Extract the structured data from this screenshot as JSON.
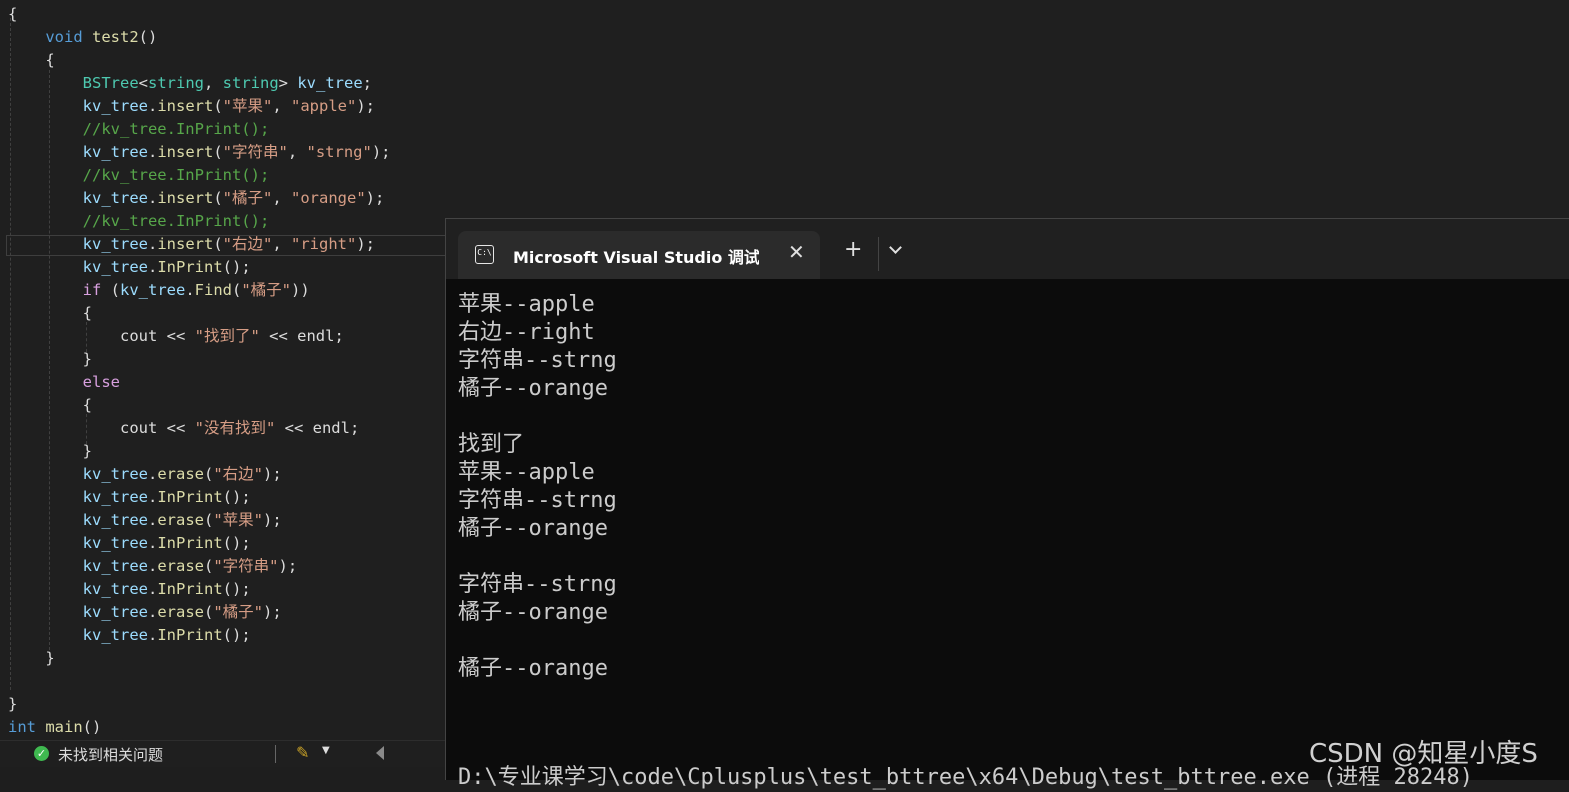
{
  "editor": {
    "lines": [
      {
        "parts": [
          {
            "c": "pl",
            "t": "{"
          }
        ]
      },
      {
        "parts": [
          {
            "c": "pl",
            "t": "    "
          },
          {
            "c": "kw",
            "t": "void"
          },
          {
            "c": "pl",
            "t": " "
          },
          {
            "c": "fn",
            "t": "test2"
          },
          {
            "c": "pl",
            "t": "()"
          }
        ]
      },
      {
        "parts": [
          {
            "c": "pl",
            "t": "    {"
          }
        ]
      },
      {
        "parts": [
          {
            "c": "pl",
            "t": "        "
          },
          {
            "c": "ty",
            "t": "BSTree"
          },
          {
            "c": "pl",
            "t": "<"
          },
          {
            "c": "ty",
            "t": "string"
          },
          {
            "c": "pl",
            "t": ", "
          },
          {
            "c": "ty",
            "t": "string"
          },
          {
            "c": "pl",
            "t": "> "
          },
          {
            "c": "id",
            "t": "kv_tree"
          },
          {
            "c": "pl",
            "t": ";"
          }
        ]
      },
      {
        "parts": [
          {
            "c": "pl",
            "t": "        "
          },
          {
            "c": "id",
            "t": "kv_tree"
          },
          {
            "c": "pl",
            "t": "."
          },
          {
            "c": "fn",
            "t": "insert"
          },
          {
            "c": "pl",
            "t": "("
          },
          {
            "c": "st",
            "t": "\"苹果\""
          },
          {
            "c": "pl",
            "t": ", "
          },
          {
            "c": "st",
            "t": "\"apple\""
          },
          {
            "c": "pl",
            "t": ");"
          }
        ]
      },
      {
        "parts": [
          {
            "c": "pl",
            "t": "        "
          },
          {
            "c": "cm",
            "t": "//kv_tree.InPrint();"
          }
        ]
      },
      {
        "parts": [
          {
            "c": "pl",
            "t": "        "
          },
          {
            "c": "id",
            "t": "kv_tree"
          },
          {
            "c": "pl",
            "t": "."
          },
          {
            "c": "fn",
            "t": "insert"
          },
          {
            "c": "pl",
            "t": "("
          },
          {
            "c": "st",
            "t": "\"字符串\""
          },
          {
            "c": "pl",
            "t": ", "
          },
          {
            "c": "st",
            "t": "\"strng\""
          },
          {
            "c": "pl",
            "t": ");"
          }
        ]
      },
      {
        "parts": [
          {
            "c": "pl",
            "t": "        "
          },
          {
            "c": "cm",
            "t": "//kv_tree.InPrint();"
          }
        ]
      },
      {
        "parts": [
          {
            "c": "pl",
            "t": "        "
          },
          {
            "c": "id",
            "t": "kv_tree"
          },
          {
            "c": "pl",
            "t": "."
          },
          {
            "c": "fn",
            "t": "insert"
          },
          {
            "c": "pl",
            "t": "("
          },
          {
            "c": "st",
            "t": "\"橘子\""
          },
          {
            "c": "pl",
            "t": ", "
          },
          {
            "c": "st",
            "t": "\"orange\""
          },
          {
            "c": "pl",
            "t": ");"
          }
        ]
      },
      {
        "parts": [
          {
            "c": "pl",
            "t": "        "
          },
          {
            "c": "cm",
            "t": "//kv_tree.InPrint();"
          }
        ]
      },
      {
        "parts": [
          {
            "c": "pl",
            "t": "        "
          },
          {
            "c": "id",
            "t": "kv_tree"
          },
          {
            "c": "pl",
            "t": "."
          },
          {
            "c": "fn",
            "t": "insert"
          },
          {
            "c": "pl",
            "t": "("
          },
          {
            "c": "st",
            "t": "\"右边\""
          },
          {
            "c": "pl",
            "t": ", "
          },
          {
            "c": "st",
            "t": "\"right\""
          },
          {
            "c": "pl",
            "t": ");"
          }
        ]
      },
      {
        "parts": [
          {
            "c": "pl",
            "t": "        "
          },
          {
            "c": "id",
            "t": "kv_tree"
          },
          {
            "c": "pl",
            "t": "."
          },
          {
            "c": "fn",
            "t": "InPrint"
          },
          {
            "c": "pl",
            "t": "();"
          }
        ]
      },
      {
        "parts": [
          {
            "c": "pl",
            "t": "        "
          },
          {
            "c": "kw2",
            "t": "if"
          },
          {
            "c": "pl",
            "t": " ("
          },
          {
            "c": "id",
            "t": "kv_tree"
          },
          {
            "c": "pl",
            "t": "."
          },
          {
            "c": "fn",
            "t": "Find"
          },
          {
            "c": "pl",
            "t": "("
          },
          {
            "c": "st",
            "t": "\"橘子\""
          },
          {
            "c": "pl",
            "t": "))"
          }
        ]
      },
      {
        "parts": [
          {
            "c": "pl",
            "t": "        {"
          }
        ]
      },
      {
        "parts": [
          {
            "c": "pl",
            "t": "            cout << "
          },
          {
            "c": "st",
            "t": "\"找到了\""
          },
          {
            "c": "pl",
            "t": " << endl;"
          }
        ]
      },
      {
        "parts": [
          {
            "c": "pl",
            "t": "        }"
          }
        ]
      },
      {
        "parts": [
          {
            "c": "pl",
            "t": "        "
          },
          {
            "c": "kw2",
            "t": "else"
          }
        ]
      },
      {
        "parts": [
          {
            "c": "pl",
            "t": "        {"
          }
        ]
      },
      {
        "parts": [
          {
            "c": "pl",
            "t": "            cout << "
          },
          {
            "c": "st",
            "t": "\"没有找到\""
          },
          {
            "c": "pl",
            "t": " << endl;"
          }
        ]
      },
      {
        "parts": [
          {
            "c": "pl",
            "t": "        }"
          }
        ]
      },
      {
        "parts": [
          {
            "c": "pl",
            "t": "        "
          },
          {
            "c": "id",
            "t": "kv_tree"
          },
          {
            "c": "pl",
            "t": "."
          },
          {
            "c": "fn",
            "t": "erase"
          },
          {
            "c": "pl",
            "t": "("
          },
          {
            "c": "st",
            "t": "\"右边\""
          },
          {
            "c": "pl",
            "t": ");"
          }
        ]
      },
      {
        "parts": [
          {
            "c": "pl",
            "t": "        "
          },
          {
            "c": "id",
            "t": "kv_tree"
          },
          {
            "c": "pl",
            "t": "."
          },
          {
            "c": "fn",
            "t": "InPrint"
          },
          {
            "c": "pl",
            "t": "();"
          }
        ]
      },
      {
        "parts": [
          {
            "c": "pl",
            "t": "        "
          },
          {
            "c": "id",
            "t": "kv_tree"
          },
          {
            "c": "pl",
            "t": "."
          },
          {
            "c": "fn",
            "t": "erase"
          },
          {
            "c": "pl",
            "t": "("
          },
          {
            "c": "st",
            "t": "\"苹果\""
          },
          {
            "c": "pl",
            "t": ");"
          }
        ]
      },
      {
        "parts": [
          {
            "c": "pl",
            "t": "        "
          },
          {
            "c": "id",
            "t": "kv_tree"
          },
          {
            "c": "pl",
            "t": "."
          },
          {
            "c": "fn",
            "t": "InPrint"
          },
          {
            "c": "pl",
            "t": "();"
          }
        ]
      },
      {
        "parts": [
          {
            "c": "pl",
            "t": "        "
          },
          {
            "c": "id",
            "t": "kv_tree"
          },
          {
            "c": "pl",
            "t": "."
          },
          {
            "c": "fn",
            "t": "erase"
          },
          {
            "c": "pl",
            "t": "("
          },
          {
            "c": "st",
            "t": "\"字符串\""
          },
          {
            "c": "pl",
            "t": ");"
          }
        ]
      },
      {
        "parts": [
          {
            "c": "pl",
            "t": "        "
          },
          {
            "c": "id",
            "t": "kv_tree"
          },
          {
            "c": "pl",
            "t": "."
          },
          {
            "c": "fn",
            "t": "InPrint"
          },
          {
            "c": "pl",
            "t": "();"
          }
        ]
      },
      {
        "parts": [
          {
            "c": "pl",
            "t": "        "
          },
          {
            "c": "id",
            "t": "kv_tree"
          },
          {
            "c": "pl",
            "t": "."
          },
          {
            "c": "fn",
            "t": "erase"
          },
          {
            "c": "pl",
            "t": "("
          },
          {
            "c": "st",
            "t": "\"橘子\""
          },
          {
            "c": "pl",
            "t": ");"
          }
        ]
      },
      {
        "parts": [
          {
            "c": "pl",
            "t": "        "
          },
          {
            "c": "id",
            "t": "kv_tree"
          },
          {
            "c": "pl",
            "t": "."
          },
          {
            "c": "fn",
            "t": "InPrint"
          },
          {
            "c": "pl",
            "t": "();"
          }
        ]
      },
      {
        "parts": [
          {
            "c": "pl",
            "t": "    }"
          }
        ]
      },
      {
        "parts": [
          {
            "c": "pl",
            "t": ""
          }
        ]
      },
      {
        "parts": [
          {
            "c": "pl",
            "t": "}"
          }
        ]
      },
      {
        "parts": [
          {
            "c": "kw",
            "t": "int"
          },
          {
            "c": "pl",
            "t": " "
          },
          {
            "c": "fn",
            "t": "main"
          },
          {
            "c": "pl",
            "t": "()"
          }
        ]
      }
    ]
  },
  "status_bar": {
    "issues_text": "未找到相关问题",
    "check_icon": "check-circle-icon",
    "brush_icon": "cleanup-brush-icon"
  },
  "terminal": {
    "tab_title": "Microsoft Visual Studio 调试控",
    "tab_icon": "console-icon",
    "tab_icon_text": "C:\\",
    "close_glyph": "✕",
    "new_tab_glyph": "+",
    "output": [
      "苹果--apple",
      "右边--right",
      "字符串--strng",
      "橘子--orange",
      "",
      "找到了",
      "苹果--apple",
      "字符串--strng",
      "橘子--orange",
      "",
      "字符串--strng",
      "橘子--orange",
      "",
      "橘子--orange"
    ],
    "exit_path": "D:\\专业课学习\\code\\Cplusplus\\test_bttree\\x64\\Debug\\test_bttree.exe (进程 28248)"
  },
  "watermark": "CSDN @知星小度S",
  "colors": {
    "editor_bg": "#1f1f1f",
    "terminal_bg": "#0c0c0c",
    "keyword": "#569cd6",
    "type": "#4ec9b0",
    "string": "#d69d85",
    "comment": "#57a64a"
  }
}
